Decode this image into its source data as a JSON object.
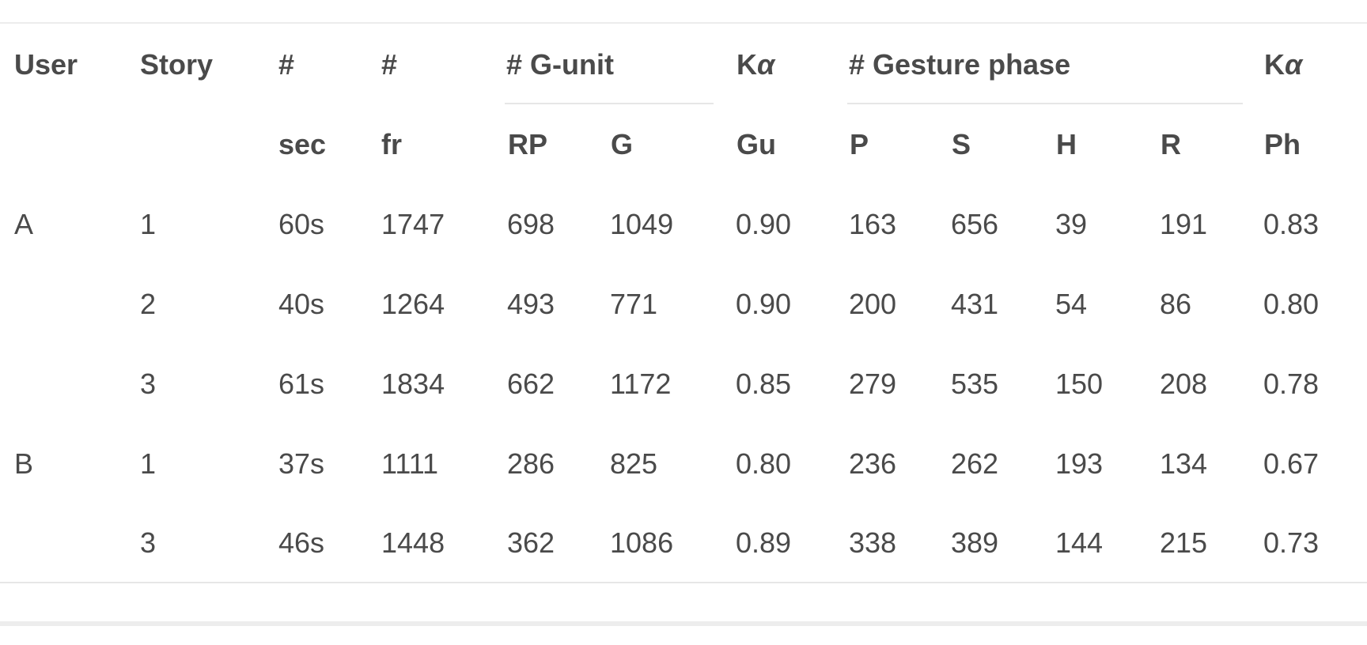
{
  "table": {
    "header_top": {
      "user": "User",
      "story": "Story",
      "sec_hash": "#",
      "fr_hash": "#",
      "gunit_group": "# G-unit",
      "ka_gu_prefix": "K",
      "ka_gu_alpha": "α",
      "gesture_group": "# Gesture phase",
      "ka_ph_prefix": "K",
      "ka_ph_alpha": "α"
    },
    "header_sub": {
      "sec": "sec",
      "fr": "fr",
      "rp": "RP",
      "g": "G",
      "gu": "Gu",
      "p": "P",
      "s": "S",
      "h": "H",
      "r": "R",
      "ph": "Ph"
    },
    "rows": [
      {
        "user": "A",
        "story": "1",
        "sec": "60s",
        "fr": "1747",
        "rp": "698",
        "g": "1049",
        "ka_gu": "0.90",
        "p": "163",
        "s": "656",
        "h": "39",
        "r": "191",
        "ka_ph": "0.83"
      },
      {
        "user": "",
        "story": "2",
        "sec": "40s",
        "fr": "1264",
        "rp": "493",
        "g": "771",
        "ka_gu": "0.90",
        "p": "200",
        "s": "431",
        "h": "54",
        "r": "86",
        "ka_ph": "0.80"
      },
      {
        "user": "",
        "story": "3",
        "sec": "61s",
        "fr": "1834",
        "rp": "662",
        "g": "1172",
        "ka_gu": "0.85",
        "p": "279",
        "s": "535",
        "h": "150",
        "r": "208",
        "ka_ph": "0.78"
      },
      {
        "user": "B",
        "story": "1",
        "sec": "37s",
        "fr": "1111",
        "rp": "286",
        "g": "825",
        "ka_gu": "0.80",
        "p": "236",
        "s": "262",
        "h": "193",
        "r": "134",
        "ka_ph": "0.67"
      },
      {
        "user": "",
        "story": "3",
        "sec": "46s",
        "fr": "1448",
        "rp": "362",
        "g": "1086",
        "ka_gu": "0.89",
        "p": "338",
        "s": "389",
        "h": "144",
        "r": "215",
        "ka_ph": "0.73"
      }
    ]
  }
}
